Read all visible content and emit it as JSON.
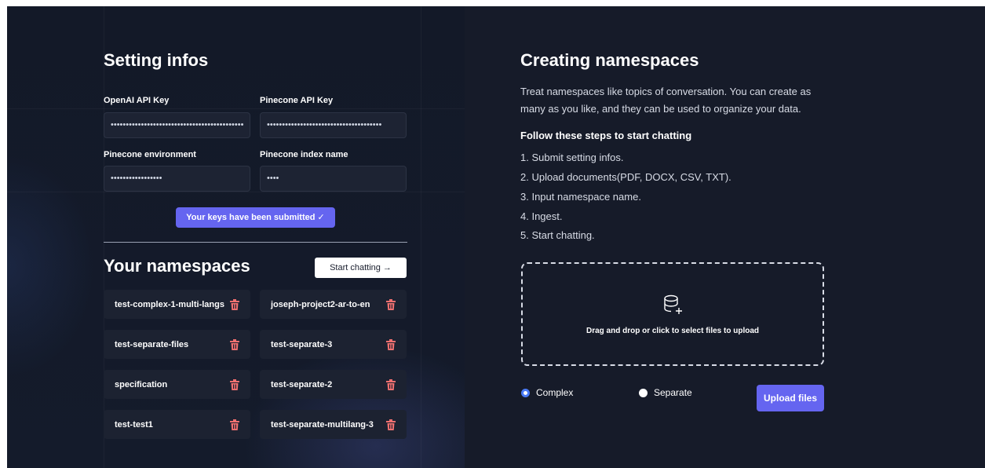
{
  "settings": {
    "title": "Setting infos",
    "openai_label": "OpenAI API Key",
    "openai_value": "••••••••••••••••••••••••••••••••••••••••••••",
    "pinecone_key_label": "Pinecone API Key",
    "pinecone_key_value": "••••••••••••••••••••••••••••••••••••••",
    "pinecone_env_label": "Pinecone environment",
    "pinecone_env_value": "•••••••••••••••••",
    "pinecone_index_label": "Pinecone index name",
    "pinecone_index_value": "••••",
    "submitted_label": "Your keys have been submitted ✓"
  },
  "namespaces": {
    "title": "Your namespaces",
    "start_chatting": "Start chatting →",
    "items": [
      "test-complex-1-multi-langs",
      "joseph-project2-ar-to-en",
      "test-separate-files",
      "test-separate-3",
      "specification",
      "test-separate-2",
      "test-test1",
      "test-separate-multilang-3"
    ]
  },
  "creating": {
    "title": "Creating namespaces",
    "description": "Treat namespaces like topics of conversation. You can create as many as you like, and they can be used to organize your data.",
    "steps_heading": "Follow these steps to start chatting",
    "steps": [
      "1. Submit setting infos.",
      "2. Upload documents(PDF, DOCX, CSV, TXT).",
      "3. Input namespace name.",
      "4. Ingest.",
      "5. Start chatting."
    ],
    "dropzone_text": "Drag and drop or click to select files to upload",
    "mode_complex": "Complex",
    "mode_separate": "Separate",
    "selected_mode": "Complex",
    "upload_button": "Upload files"
  },
  "colors": {
    "accent": "#6565f0",
    "trash": "#f07070",
    "background": "#151a28"
  }
}
